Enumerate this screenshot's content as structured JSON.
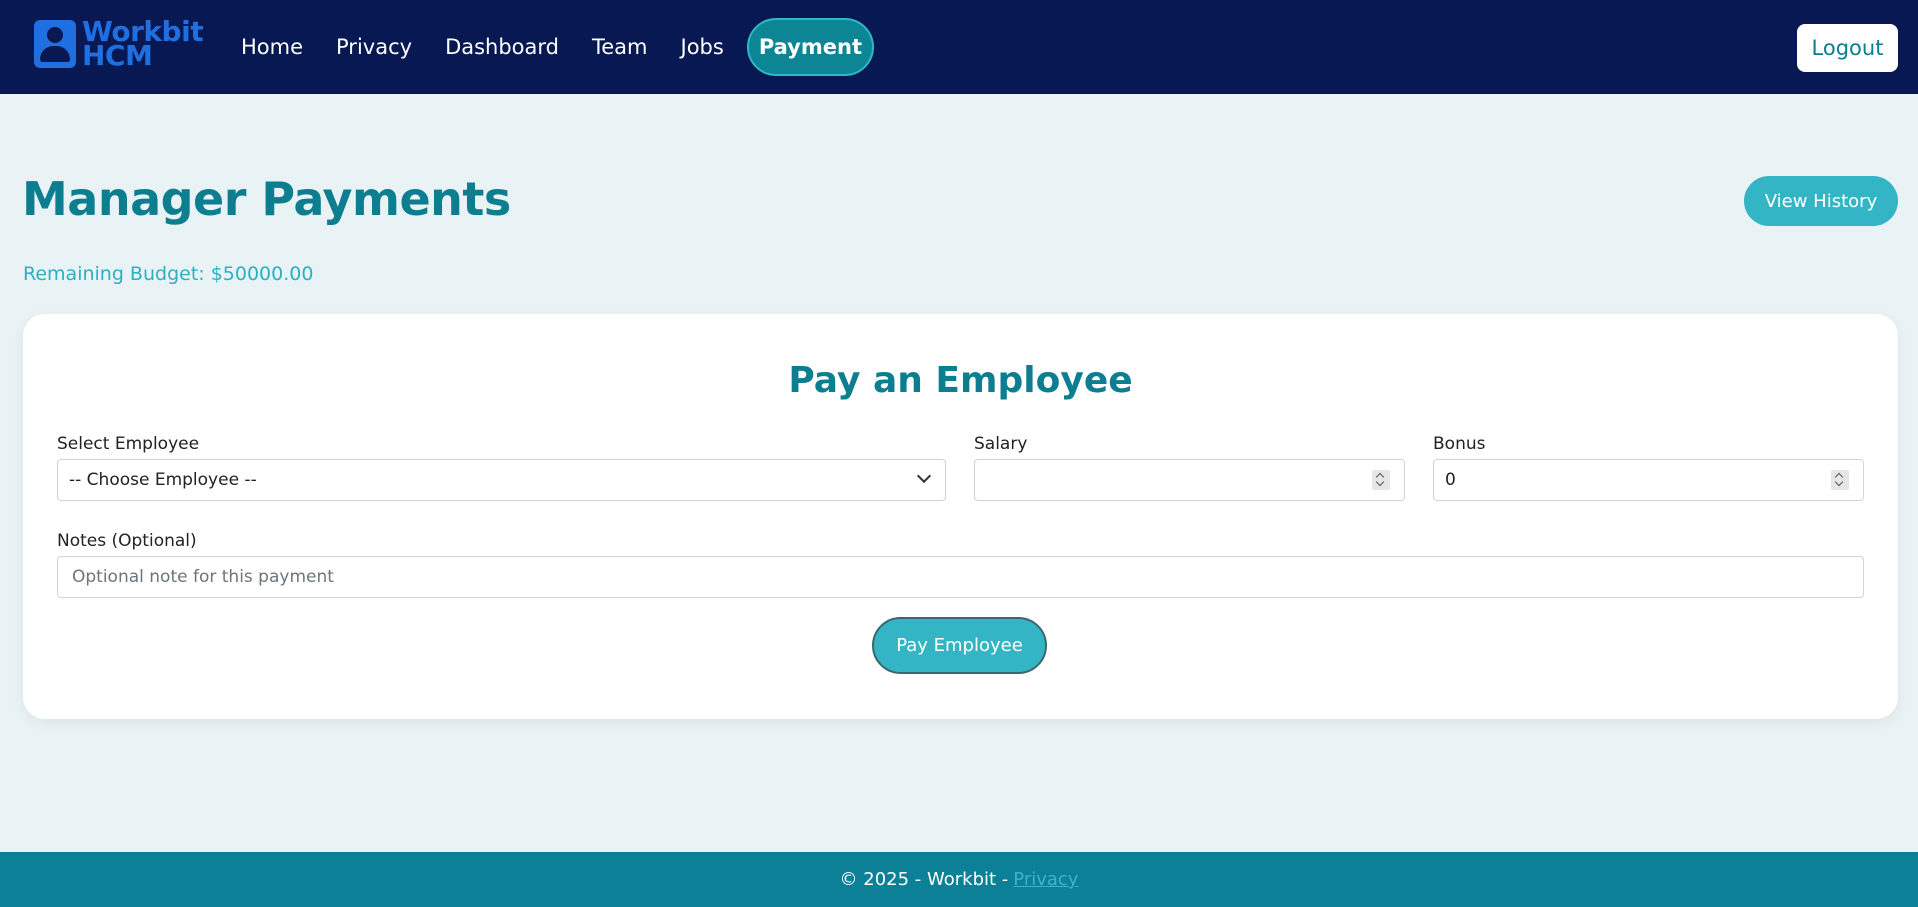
{
  "brand": {
    "line1": "Workbit",
    "line2": "HCM"
  },
  "nav": {
    "items": [
      {
        "label": "Home"
      },
      {
        "label": "Privacy"
      },
      {
        "label": "Dashboard"
      },
      {
        "label": "Team"
      },
      {
        "label": "Jobs"
      },
      {
        "label": "Payment"
      }
    ],
    "active": "Payment",
    "logout_label": "Logout"
  },
  "header": {
    "title": "Manager Payments",
    "view_history_label": "View History",
    "budget_text": "Remaining Budget: $50000.00"
  },
  "form": {
    "title": "Pay an Employee",
    "employee": {
      "label": "Select Employee",
      "selected": "-- Choose Employee --"
    },
    "salary": {
      "label": "Salary",
      "value": ""
    },
    "bonus": {
      "label": "Bonus",
      "value": "0"
    },
    "notes": {
      "label": "Notes (Optional)",
      "placeholder": "Optional note for this payment"
    },
    "submit_label": "Pay Employee"
  },
  "footer": {
    "text": "© 2025 - Workbit -",
    "link_label": "Privacy"
  },
  "colors": {
    "navbar": "#071852",
    "accent": "#0c7e90",
    "button": "#34b5c5",
    "background": "#e9f3f5"
  }
}
